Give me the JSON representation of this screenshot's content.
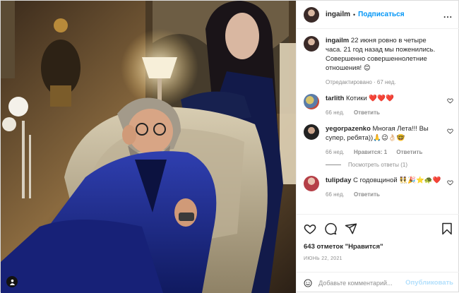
{
  "post": {
    "username": "ingailm",
    "header_separator": "•",
    "follow_label": "Подписаться",
    "more_label": "...",
    "caption": "22 июня ровно в четыре часа. 21 год назад мы поженились. Совершенно совершеннолетние отношения! 😊",
    "caption_meta": "Отредактировано · 67 нед."
  },
  "comments": [
    {
      "username": "tarlith",
      "text": "Котики ❤️❤️❤️",
      "time": "66 нед.",
      "reply_label": "Ответить",
      "likes_label": ""
    },
    {
      "username": "yegorpazenko",
      "text": "Многая Лета!!! Вы супер, ребята))🙏😉👌🏻🤓",
      "time": "66 нед.",
      "likes_label": "Нравится: 1",
      "reply_label": "Ответить",
      "view_replies": "Посмотреть ответы (1)"
    },
    {
      "username": "tulipday",
      "text": "С годовщиной 👯🎉⭐️🐢❤️",
      "time": "66 нед.",
      "reply_label": "Ответить",
      "likes_label": ""
    }
  ],
  "actions": {
    "icons": [
      "heart-icon",
      "comment-icon",
      "share-icon",
      "bookmark-icon"
    ],
    "likes": "643 отметок \"Нравится\"",
    "date": "Июнь 22, 2021"
  },
  "add_comment": {
    "placeholder": "Добавьте комментарий...",
    "publish_label": "Опубликовать"
  },
  "colors": {
    "accent": "#0095f6",
    "publish_disabled": "#b2dffc",
    "muted": "#8e8e8e",
    "heart": "#e0245e"
  }
}
